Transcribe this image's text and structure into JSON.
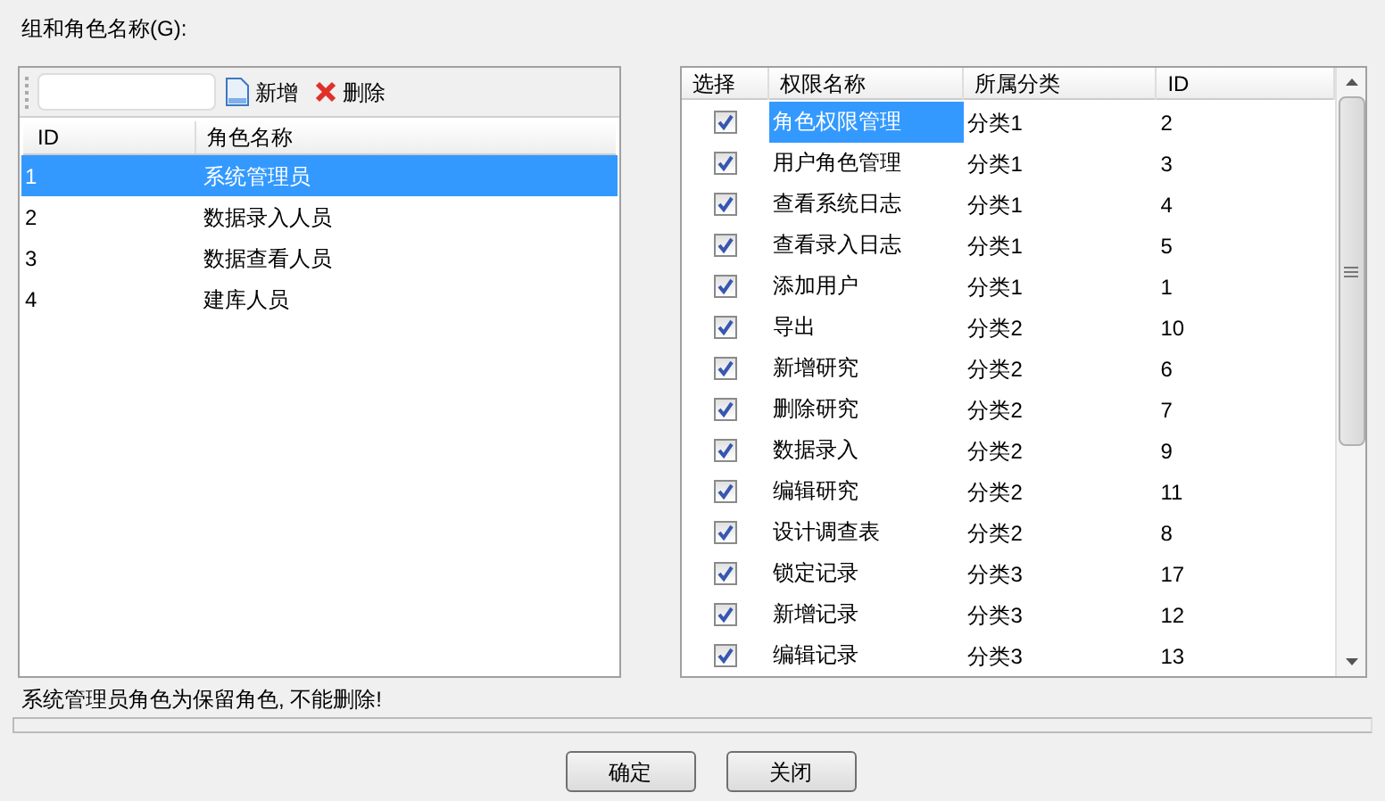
{
  "group_label": "组和角色名称(G):",
  "toolbar": {
    "add": "新增",
    "delete": "删除"
  },
  "roles": {
    "columns": [
      "ID",
      "角色名称"
    ],
    "rows": [
      {
        "id": "1",
        "name": "系统管理员",
        "selected": true
      },
      {
        "id": "2",
        "name": "数据录入人员",
        "selected": false
      },
      {
        "id": "3",
        "name": "数据查看人员",
        "selected": false
      },
      {
        "id": "4",
        "name": "建库人员",
        "selected": false
      }
    ]
  },
  "permissions": {
    "columns": [
      "选择",
      "权限名称",
      "所属分类",
      "ID"
    ],
    "rows": [
      {
        "checked": true,
        "name": "角色权限管理",
        "category": "分类1",
        "id": "2",
        "selected": true
      },
      {
        "checked": true,
        "name": "用户角色管理",
        "category": "分类1",
        "id": "3",
        "selected": false
      },
      {
        "checked": true,
        "name": "查看系统日志",
        "category": "分类1",
        "id": "4",
        "selected": false
      },
      {
        "checked": true,
        "name": "查看录入日志",
        "category": "分类1",
        "id": "5",
        "selected": false
      },
      {
        "checked": true,
        "name": "添加用户",
        "category": "分类1",
        "id": "1",
        "selected": false
      },
      {
        "checked": true,
        "name": "导出",
        "category": "分类2",
        "id": "10",
        "selected": false
      },
      {
        "checked": true,
        "name": "新增研究",
        "category": "分类2",
        "id": "6",
        "selected": false
      },
      {
        "checked": true,
        "name": "删除研究",
        "category": "分类2",
        "id": "7",
        "selected": false
      },
      {
        "checked": true,
        "name": "数据录入",
        "category": "分类2",
        "id": "9",
        "selected": false
      },
      {
        "checked": true,
        "name": "编辑研究",
        "category": "分类2",
        "id": "11",
        "selected": false
      },
      {
        "checked": true,
        "name": "设计调查表",
        "category": "分类2",
        "id": "8",
        "selected": false
      },
      {
        "checked": true,
        "name": "锁定记录",
        "category": "分类3",
        "id": "17",
        "selected": false
      },
      {
        "checked": true,
        "name": "新增记录",
        "category": "分类3",
        "id": "12",
        "selected": false
      },
      {
        "checked": true,
        "name": "编辑记录",
        "category": "分类3",
        "id": "13",
        "selected": false
      }
    ]
  },
  "message": "系统管理员角色为保留角色, 不能删除!",
  "buttons": [
    "确定",
    "关闭"
  ]
}
